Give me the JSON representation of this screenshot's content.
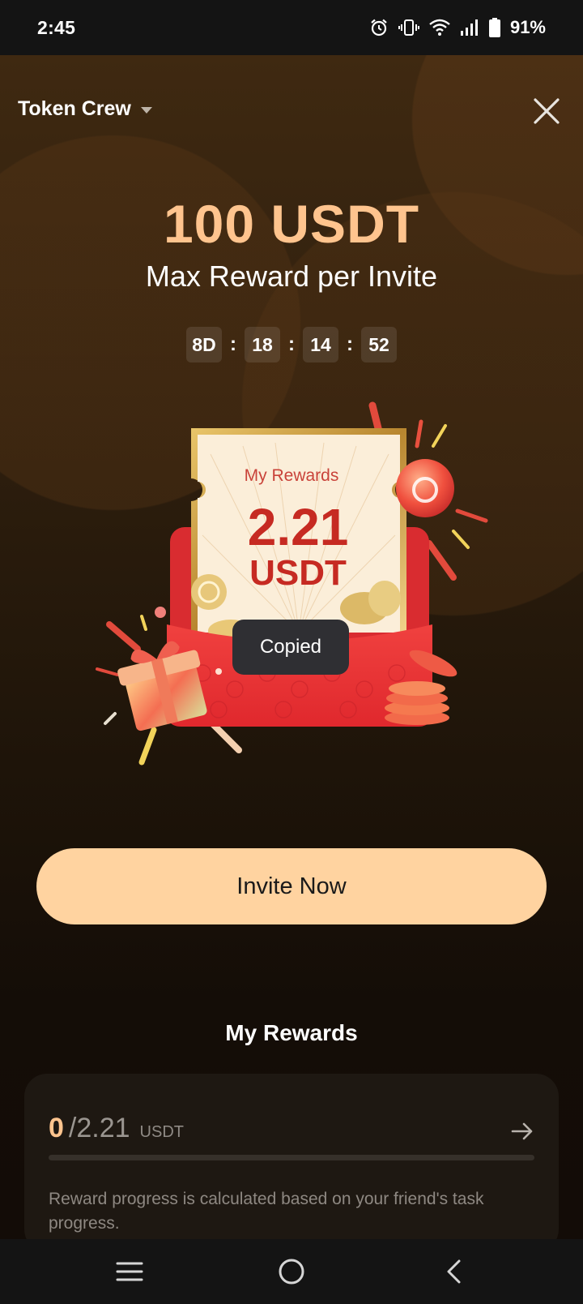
{
  "status_bar": {
    "time": "2:45",
    "battery": "91%"
  },
  "header": {
    "title": "Token Crew"
  },
  "hero": {
    "amount": "100 USDT",
    "subtitle": "Max Reward per Invite",
    "countdown": {
      "days": "8D",
      "hours": "18",
      "minutes": "14",
      "seconds": "52",
      "separator": ":"
    }
  },
  "ticket": {
    "label": "My Rewards",
    "value": "2.21",
    "unit": "USDT"
  },
  "toast": {
    "text": "Copied"
  },
  "invite_button": {
    "label": "Invite Now"
  },
  "rewards_section": {
    "title": "My Rewards",
    "current": "0",
    "total": "/2.21",
    "unit": "USDT",
    "progress_fraction": 0,
    "note": "Reward progress is calculated based on your friend's task progress."
  },
  "colors": {
    "accent": "#ffc48e",
    "button": "#ffd3a0",
    "ticket_red": "#c62a22"
  },
  "icons": [
    "alarm-icon",
    "vibrate-icon",
    "wifi-icon",
    "signal-icon",
    "battery-icon",
    "caret-down-icon",
    "close-icon",
    "arrow-right-icon",
    "menu-icon",
    "home-icon",
    "back-icon"
  ]
}
